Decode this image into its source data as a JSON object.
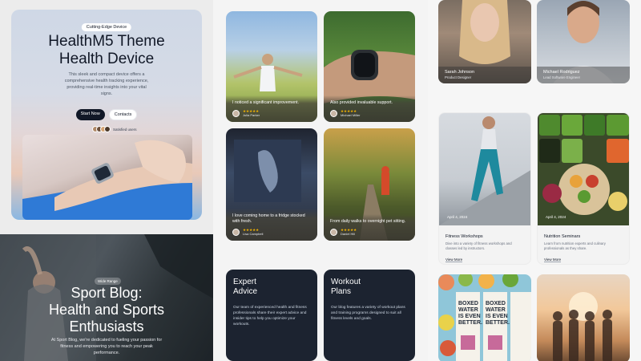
{
  "hero": {
    "tag": "Cutting-Edge Device",
    "title_line1": "HealthM5 Theme",
    "title_line2": "Health Device",
    "description": "This sleek and compact device offers a comprehensive health tracking experience, providing real-time insights into your vital signs.",
    "buttons": {
      "primary": "Start Now",
      "secondary": "Contacts"
    },
    "social_proof": "Satisfied users"
  },
  "sport_blog": {
    "tag": "Wide Range",
    "title_line1": "Sport Blog:",
    "title_line2": "Health and Sports",
    "title_line3": "Enthusiasts",
    "description": "At Sport Blog, we're dedicated to fueling your passion for fitness and empowering you to reach your peak performance."
  },
  "testimonials": [
    {
      "quote": "I noticed a significant improvement.",
      "stars": "★★★★★",
      "name": "Julia Parker"
    },
    {
      "quote": "Also provided invaluable support.",
      "stars": "★★★★★",
      "name": "Michael Miller"
    },
    {
      "quote": "I love coming home to a fridge stocked with fresh.",
      "stars": "★★★★★",
      "name": "Lisa Campbell"
    },
    {
      "quote": "From daily walks to overnight pet sitting.",
      "stars": "★★★★★",
      "name": "Daniel Hill"
    }
  ],
  "info_cards": [
    {
      "title_line1": "Expert",
      "title_line2": "Advice",
      "description": "Our team of experienced health and fitness professionals share their expert advice and insider tips to help you optimize your workouts."
    },
    {
      "title_line1": "Workout",
      "title_line2": "Plans",
      "description": "Our blog features a variety of workout plans and training programs designed to suit all fitness levels and goals."
    }
  ],
  "team": [
    {
      "name": "Sarah Johnson",
      "role": "Product Designer"
    },
    {
      "name": "Michael Rodriguez",
      "role": "Lead Software Engineer"
    }
  ],
  "services": [
    {
      "date": "April 4, 2024",
      "title": "Fitness Workshops",
      "description": "Dive into a variety of fitness workshops and classes led by instructors.",
      "link": "View More"
    },
    {
      "date": "April 4, 2024",
      "title": "Nutrition Seminars",
      "description": "Learn from nutrition experts and culinary professionals as they share.",
      "link": "View More"
    }
  ],
  "water_packaging_text": [
    "BOXED",
    "WATER",
    "IS EVEN",
    "BETTER."
  ]
}
